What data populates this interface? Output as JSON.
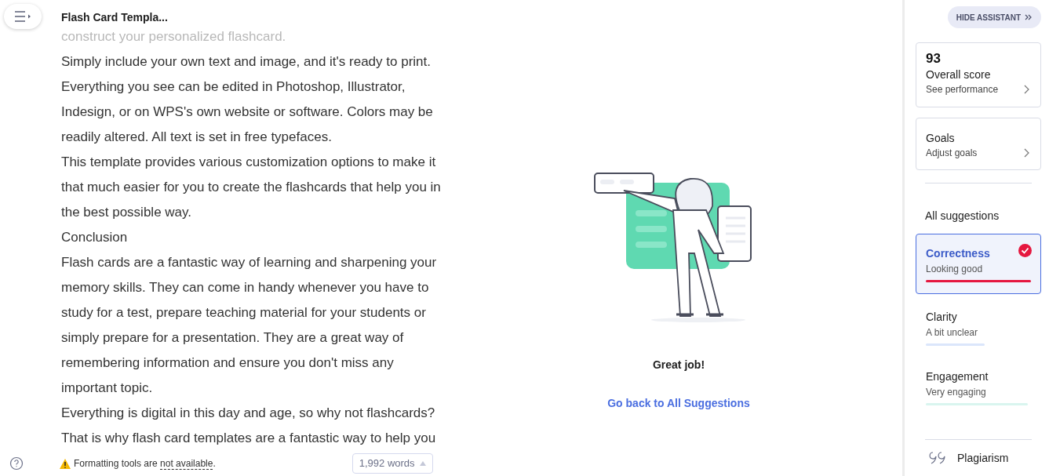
{
  "document": {
    "title": "Flash Card Templa...",
    "lines": [
      {
        "text": "construct your personalized flashcard.",
        "faded": true
      },
      {
        "text": "Simply include your own text and image, and it's ready to print.",
        "faded": false
      },
      {
        "text": "Everything you see can be edited in Photoshop, Illustrator,",
        "faded": false
      },
      {
        "text": "Indesign, or on WPS's own website or software. Colors may be",
        "faded": false
      },
      {
        "text": "readily altered. All text is set in free typefaces.",
        "faded": false
      },
      {
        "text": "This template provides various customization options to make it",
        "faded": false
      },
      {
        "text": "that much easier for you to create the flashcards that help you in",
        "faded": false
      },
      {
        "text": "the best possible way.",
        "faded": false
      },
      {
        "text": "Conclusion",
        "faded": false
      },
      {
        "text": "Flash cards are a fantastic way of learning and sharpening your",
        "faded": false
      },
      {
        "text": "memory skills. They can come in handy whenever you have to",
        "faded": false
      },
      {
        "text": "study for a test, prepare teaching material for your students or",
        "faded": false
      },
      {
        "text": "simply prepare for a presentation. They are a great way of",
        "faded": false
      },
      {
        "text": "remembering information and ensure you don't miss any",
        "faded": false
      },
      {
        "text": "important topic.",
        "faded": false
      },
      {
        "text": "Everything is digital in this day and age, so why not flashcards?",
        "faded": false
      },
      {
        "text": "That is why flash card templates are a fantastic way to help you",
        "faded": false
      }
    ]
  },
  "status_bar": {
    "warning": "Formatting tools are ",
    "warning_link": "not available",
    "warning_end": ".",
    "word_count": "1,992 words"
  },
  "panel": {
    "message": "Great job!",
    "link": "Go back to All Suggestions"
  },
  "assistant": {
    "hide_button": "HIDE ASSISTANT",
    "score": {
      "value": "93",
      "label": "Overall score",
      "link": "See performance"
    },
    "goals": {
      "label": "Goals",
      "link": "Adjust goals"
    },
    "suggestions_heading": "All suggestions",
    "categories": [
      {
        "name": "Correctness",
        "status": "Looking good",
        "selected": true,
        "done": true,
        "color": "#e5173f"
      },
      {
        "name": "Clarity",
        "status": "A bit unclear",
        "selected": false,
        "done": false,
        "color": "#dbe6fb"
      },
      {
        "name": "Engagement",
        "status": "Very engaging",
        "selected": false,
        "done": false,
        "color": "#d9f5ef"
      }
    ],
    "plagiarism": "Plagiarism"
  }
}
